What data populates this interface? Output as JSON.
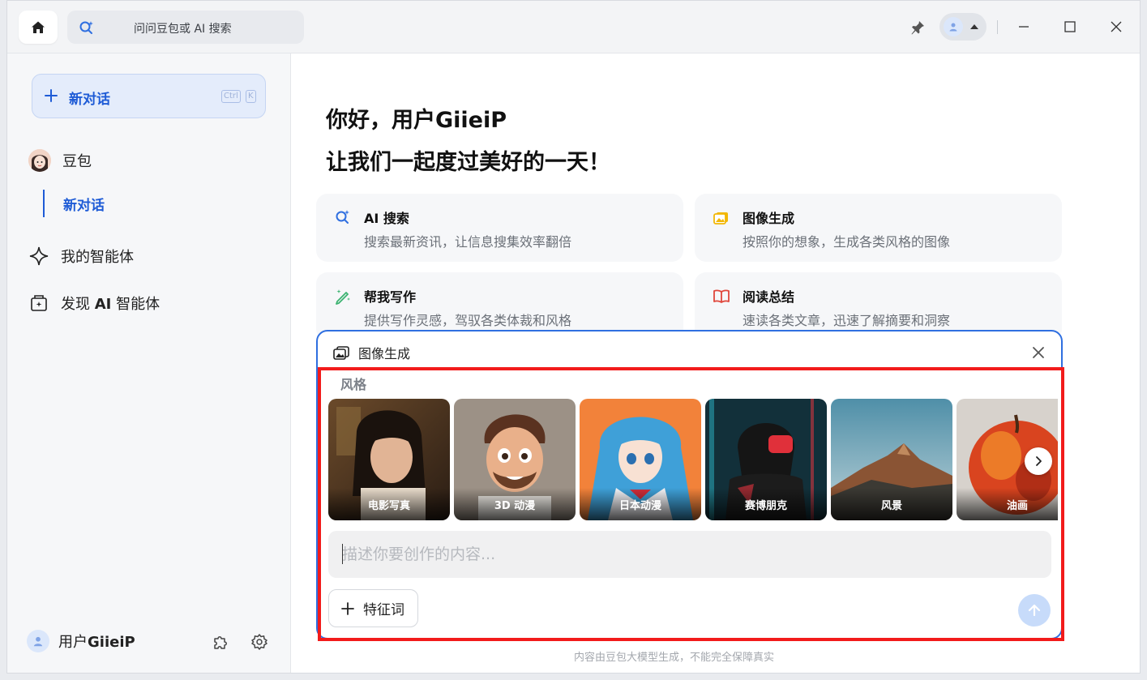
{
  "titlebar": {
    "search_placeholder": "问问豆包或 AI 搜索",
    "icons": [
      "home-icon",
      "search-ai-icon",
      "pin-icon",
      "avatar-icon",
      "minimize-icon",
      "maximize-icon",
      "close-icon"
    ]
  },
  "sidebar": {
    "new_chat_label": "新对话",
    "shortcut_keys": [
      "Ctrl",
      "K"
    ],
    "assistant_name": "豆包",
    "active_chat": "新对话",
    "my_agents": "我的智能体",
    "discover_prefix": "发现 ",
    "discover_bold": "AI",
    "discover_suffix": " 智能体",
    "user_prefix": "用户",
    "user_bold": "GiieiP"
  },
  "main": {
    "greeting_line1": "你好，用户GiieiP",
    "greeting_line2": "让我们一起度过美好的一天！",
    "cards": [
      {
        "title": "AI 搜索",
        "desc": "搜索最新资讯，让信息搜集效率翻倍",
        "icon": "ai-search-icon",
        "color": "#2f6fe0"
      },
      {
        "title": "图像生成",
        "desc": "按照你的想象，生成各类风格的图像",
        "icon": "image-gen-icon",
        "color": "#f2b705"
      },
      {
        "title": "帮我写作",
        "desc": "提供写作灵感，驾驭各类体裁和风格",
        "icon": "pen-sparkle-icon",
        "color": "#3cb371"
      },
      {
        "title": "阅读总结",
        "desc": "速读各类文章，迅速了解摘要和洞察",
        "icon": "book-icon",
        "color": "#e0463b"
      }
    ],
    "composer": {
      "mode_title": "图像生成",
      "style_label": "风格",
      "styles": [
        {
          "label": "电影写真"
        },
        {
          "label": "3D 动漫"
        },
        {
          "label": "日本动漫"
        },
        {
          "label": "赛博朋克"
        },
        {
          "label": "风景"
        },
        {
          "label": "油画"
        }
      ],
      "prompt_placeholder": "描述你要创作的内容...",
      "feature_button": "特征词"
    },
    "footnote": "内容由豆包大模型生成，不能完全保障真实"
  },
  "colors": {
    "accent": "#1e5bd6",
    "highlight_border": "#f21b1b",
    "send_disabled": "#c7dbfa"
  }
}
